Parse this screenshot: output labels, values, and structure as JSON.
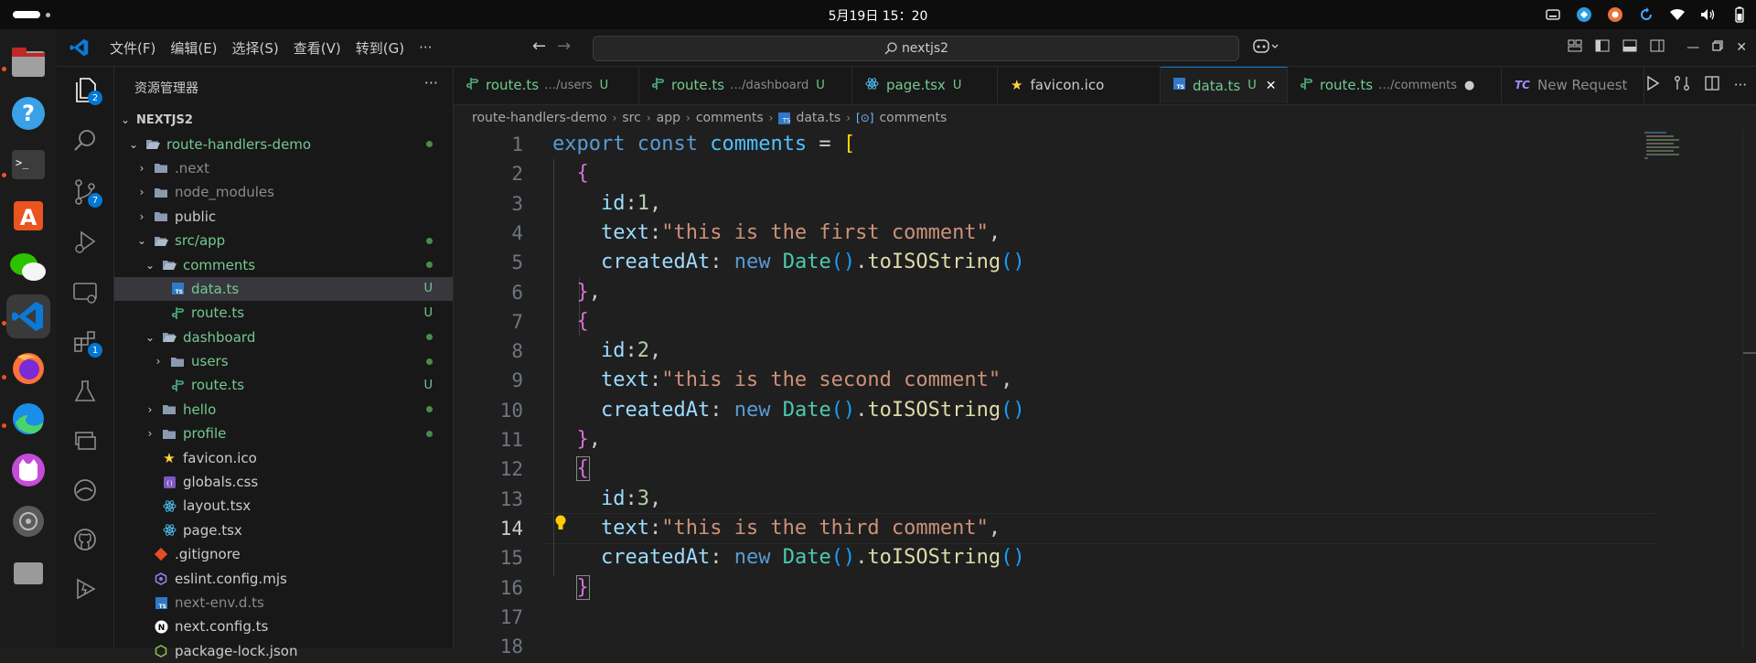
{
  "system": {
    "clock": "5月19日  15：20"
  },
  "titlebar": {
    "menus": [
      "文件(F)",
      "编辑(E)",
      "选择(S)",
      "查看(V)",
      "转到(G)",
      "···"
    ],
    "search_text": "nextjs2"
  },
  "activity": {
    "explorer_badge": "2",
    "scm_badge": "7",
    "extensions_badge": "1"
  },
  "sidebar": {
    "title": "资源管理器",
    "more": "···",
    "root": "NEXTJS2",
    "rows": [
      {
        "label": "route-handlers-demo",
        "indent": 1,
        "chev": "⌄",
        "icon": "folder-open-icon",
        "color": "#73c991",
        "status": "dot"
      },
      {
        "label": ".next",
        "indent": 2,
        "chev": "›",
        "icon": "folder-icon",
        "color": "#8b8b8b",
        "status": ""
      },
      {
        "label": "node_modules",
        "indent": 2,
        "chev": "›",
        "icon": "folder-icon",
        "color": "#8b8b8b",
        "status": ""
      },
      {
        "label": "public",
        "indent": 2,
        "chev": "›",
        "icon": "folder-icon",
        "color": "#cccccc",
        "status": ""
      },
      {
        "label": "src/app",
        "indent": 2,
        "chev": "⌄",
        "icon": "folder-open-icon",
        "color": "#73c991",
        "status": "dot"
      },
      {
        "label": "comments",
        "indent": 3,
        "chev": "⌄",
        "icon": "folder-open-icon",
        "color": "#73c991",
        "status": "dot"
      },
      {
        "label": "data.ts",
        "indent": 4,
        "chev": "",
        "icon": "ts-icon",
        "color": "#73c991",
        "status": "U",
        "selected": true
      },
      {
        "label": "route.ts",
        "indent": 4,
        "chev": "",
        "icon": "route-icon",
        "color": "#73c991",
        "status": "U"
      },
      {
        "label": "dashboard",
        "indent": 3,
        "chev": "⌄",
        "icon": "folder-open-icon",
        "color": "#73c991",
        "status": "dot"
      },
      {
        "label": "users",
        "indent": 4,
        "chev": "›",
        "icon": "folder-icon",
        "color": "#73c991",
        "status": "dot"
      },
      {
        "label": "route.ts",
        "indent": 4,
        "chev": "",
        "icon": "route-icon",
        "color": "#73c991",
        "status": "U"
      },
      {
        "label": "hello",
        "indent": 3,
        "chev": "›",
        "icon": "folder-icon",
        "color": "#73c991",
        "status": "dot"
      },
      {
        "label": "profile",
        "indent": 3,
        "chev": "›",
        "icon": "folder-icon",
        "color": "#73c991",
        "status": "dot"
      },
      {
        "label": "favicon.ico",
        "indent": 3,
        "chev": "",
        "icon": "star-icon",
        "color": "#cccccc",
        "status": ""
      },
      {
        "label": "globals.css",
        "indent": 3,
        "chev": "",
        "icon": "css-icon",
        "color": "#cccccc",
        "status": ""
      },
      {
        "label": "layout.tsx",
        "indent": 3,
        "chev": "",
        "icon": "react-icon",
        "color": "#cccccc",
        "status": ""
      },
      {
        "label": "page.tsx",
        "indent": 3,
        "chev": "",
        "icon": "react-icon",
        "color": "#cccccc",
        "status": ""
      },
      {
        "label": ".gitignore",
        "indent": 2,
        "chev": "",
        "icon": "git-icon",
        "color": "#cccccc",
        "status": ""
      },
      {
        "label": "eslint.config.mjs",
        "indent": 2,
        "chev": "",
        "icon": "eslint-icon",
        "color": "#cccccc",
        "status": ""
      },
      {
        "label": "next-env.d.ts",
        "indent": 2,
        "chev": "",
        "icon": "ts-icon",
        "color": "#8b8b8b",
        "status": ""
      },
      {
        "label": "next.config.ts",
        "indent": 2,
        "chev": "",
        "icon": "next-icon",
        "color": "#cccccc",
        "status": ""
      },
      {
        "label": "package-lock.json",
        "indent": 2,
        "chev": "",
        "icon": "json-icon",
        "color": "#cccccc",
        "status": ""
      }
    ]
  },
  "tabs": [
    {
      "label": "route.ts",
      "desc": "…/users",
      "status": "U",
      "icon": "route-icon",
      "active": false
    },
    {
      "label": "route.ts",
      "desc": "…/dashboard",
      "status": "U",
      "icon": "route-icon",
      "active": false
    },
    {
      "label": "page.tsx",
      "desc": "",
      "status": "U",
      "icon": "react-icon",
      "active": false
    },
    {
      "label": "favicon.ico",
      "desc": "",
      "status": "",
      "icon": "star-icon",
      "active": false
    },
    {
      "label": "data.ts",
      "desc": "",
      "status": "U",
      "icon": "ts-icon",
      "active": true
    },
    {
      "label": "route.ts",
      "desc": "…/comments",
      "status": "●",
      "icon": "route-icon",
      "active": false
    },
    {
      "label": "New Request",
      "desc": "",
      "status": "",
      "icon": "thunder-client-icon",
      "active": false
    }
  ],
  "breadcrumb": [
    "route-handlers-demo",
    "src",
    "app",
    "comments",
    "data.ts",
    "comments"
  ],
  "editor": {
    "current_line": 14,
    "line_numbers": [
      "1",
      "2",
      "3",
      "4",
      "5",
      "6",
      "7",
      "8",
      "9",
      "10",
      "11",
      "12",
      "13",
      "14",
      "15",
      "16",
      "17",
      "18"
    ]
  }
}
